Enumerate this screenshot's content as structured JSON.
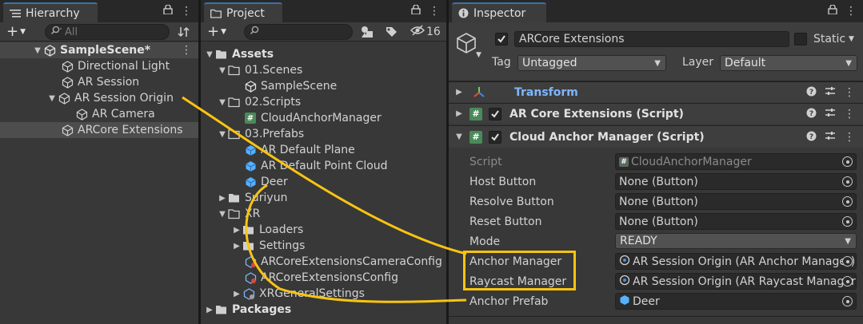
{
  "hierarchy": {
    "tab_label": "Hierarchy",
    "search_placeholder": "All",
    "scene": "SampleScene*",
    "items": [
      {
        "label": "Directional Light"
      },
      {
        "label": "AR Session"
      },
      {
        "label": "AR Session Origin"
      },
      {
        "label": "AR Camera"
      },
      {
        "label": "ARCore Extensions"
      }
    ]
  },
  "project": {
    "tab_label": "Project",
    "hidden_count": "16",
    "tree": [
      {
        "label": "Assets"
      },
      {
        "label": "01.Scenes"
      },
      {
        "label": "SampleScene"
      },
      {
        "label": "02.Scripts"
      },
      {
        "label": "CloudAnchorManager"
      },
      {
        "label": "03.Prefabs"
      },
      {
        "label": "AR Default Plane"
      },
      {
        "label": "AR Default Point Cloud"
      },
      {
        "label": "Deer"
      },
      {
        "label": "Suriyun"
      },
      {
        "label": "XR"
      },
      {
        "label": "Loaders"
      },
      {
        "label": "Settings"
      },
      {
        "label": "ARCoreExtensionsCameraConfig"
      },
      {
        "label": "ARCoreExtensionsConfig"
      },
      {
        "label": "XRGeneralSettings"
      },
      {
        "label": "Packages"
      }
    ]
  },
  "inspector": {
    "tab_label": "Inspector",
    "object_name": "ARCore Extensions",
    "static_label": "Static",
    "tag_label": "Tag",
    "tag_value": "Untagged",
    "layer_label": "Layer",
    "layer_value": "Default",
    "components": [
      {
        "label": "Transform"
      },
      {
        "label": "AR Core Extensions (Script)"
      },
      {
        "label": "Cloud Anchor Manager (Script)"
      }
    ],
    "properties": [
      {
        "label": "Script",
        "value": "CloudAnchorManager"
      },
      {
        "label": "Host Button",
        "value": "None (Button)"
      },
      {
        "label": "Resolve Button",
        "value": "None (Button)"
      },
      {
        "label": "Reset Button",
        "value": "None (Button)"
      },
      {
        "label": "Mode",
        "value": "READY"
      },
      {
        "label": "Anchor Manager",
        "value": "AR Session Origin (AR Anchor Manager)"
      },
      {
        "label": "Raycast Manager",
        "value": "AR Session Origin (AR Raycast Manager)"
      },
      {
        "label": "Anchor Prefab",
        "value": "Deer"
      }
    ]
  },
  "colors": {
    "highlight": "#f8c412",
    "selection": "#4d4d4d",
    "accent": "#3a72b0",
    "transform_label": "#7fb6ff"
  }
}
